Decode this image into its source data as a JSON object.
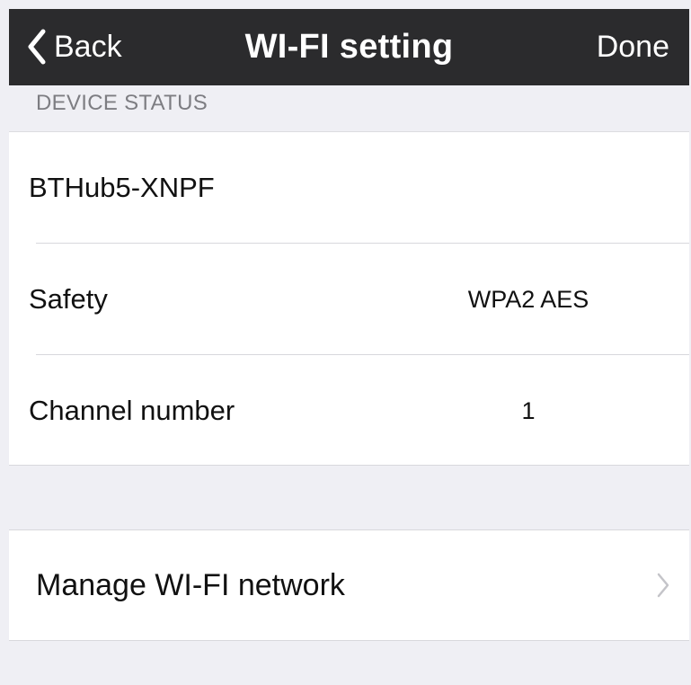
{
  "navbar": {
    "back_label": "Back",
    "title": "WI-FI setting",
    "done_label": "Done",
    "back_icon": "chevron-left-icon"
  },
  "section": {
    "header": "DEVICE STATUS"
  },
  "status_rows": [
    {
      "title": "BTHub5-XNPF",
      "value": ""
    },
    {
      "title": "Safety",
      "value": "WPA2 AES"
    },
    {
      "title": "Channel number",
      "value": "1"
    }
  ],
  "manage": {
    "label": "Manage WI-FI network",
    "icon": "chevron-right-icon"
  },
  "colors": {
    "navbar_bg": "#2b2b2d",
    "grouped_bg": "#efeff4",
    "cell_bg": "#ffffff"
  }
}
